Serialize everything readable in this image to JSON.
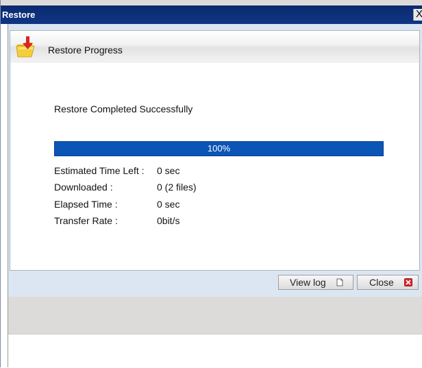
{
  "window": {
    "title": "Restore",
    "close_glyph": "X"
  },
  "panel": {
    "title": "Restore Progress",
    "icon": "folder-restore-icon"
  },
  "status": {
    "message": "Restore Completed Successfully"
  },
  "progress": {
    "percent": 100,
    "label": "100%"
  },
  "info": {
    "rows": [
      {
        "label": "Estimated Time Left :",
        "value": "0 sec"
      },
      {
        "label": "Downloaded :",
        "value": "0 (2 files)"
      },
      {
        "label": "Elapsed Time :",
        "value": "0 sec"
      },
      {
        "label": "Transfer Rate :",
        "value": "0bit/s"
      }
    ]
  },
  "buttons": {
    "view_log": {
      "label": "View log",
      "icon": "document-icon"
    },
    "close": {
      "label": "Close",
      "icon": "close-red-icon"
    }
  },
  "colors": {
    "titlebar": "#0c2f7a",
    "progress_fill": "#0a55b6",
    "close_icon": "#d7262a"
  }
}
